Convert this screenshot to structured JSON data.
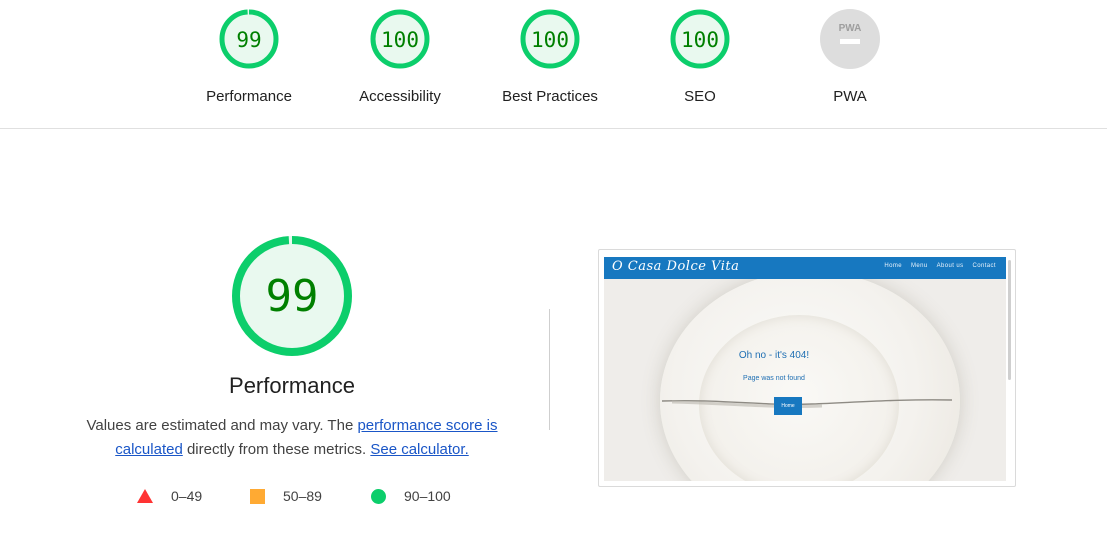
{
  "gauges": [
    {
      "label": "Performance",
      "score": "99",
      "fraction": 0.99,
      "status": "pass"
    },
    {
      "label": "Accessibility",
      "score": "100",
      "fraction": 1.0,
      "status": "pass"
    },
    {
      "label": "Best Practices",
      "score": "100",
      "fraction": 1.0,
      "status": "pass"
    },
    {
      "label": "SEO",
      "score": "100",
      "fraction": 1.0,
      "status": "pass"
    },
    {
      "label": "PWA",
      "badge": "PWA",
      "status": "na"
    }
  ],
  "performance": {
    "score": "99",
    "fraction": 0.99,
    "title": "Performance",
    "desc_prefix": "Values are estimated and may vary. The ",
    "link_score": "performance score is calculated",
    "desc_middle": " directly from these metrics. ",
    "link_calc": "See calculator."
  },
  "legend": [
    {
      "shape": "triangle",
      "range": "0–49",
      "color": "#ff3333"
    },
    {
      "shape": "square",
      "range": "50–89",
      "color": "#ffaa33"
    },
    {
      "shape": "circle",
      "range": "90–100",
      "color": "#0cce6b"
    }
  ],
  "colors": {
    "pass": "#0cce6b",
    "pass_bg": "#e9f9ef",
    "pass_text": "#008000",
    "na": "#dddddd",
    "link": "#1a56c7"
  },
  "screenshot": {
    "brand": "O Casa Dolce Vita",
    "nav": [
      "Home",
      "Menu",
      "About us",
      "Contact"
    ],
    "heading": "Oh no - it's 404!",
    "subtext": "Page was not found",
    "button": "Home"
  }
}
